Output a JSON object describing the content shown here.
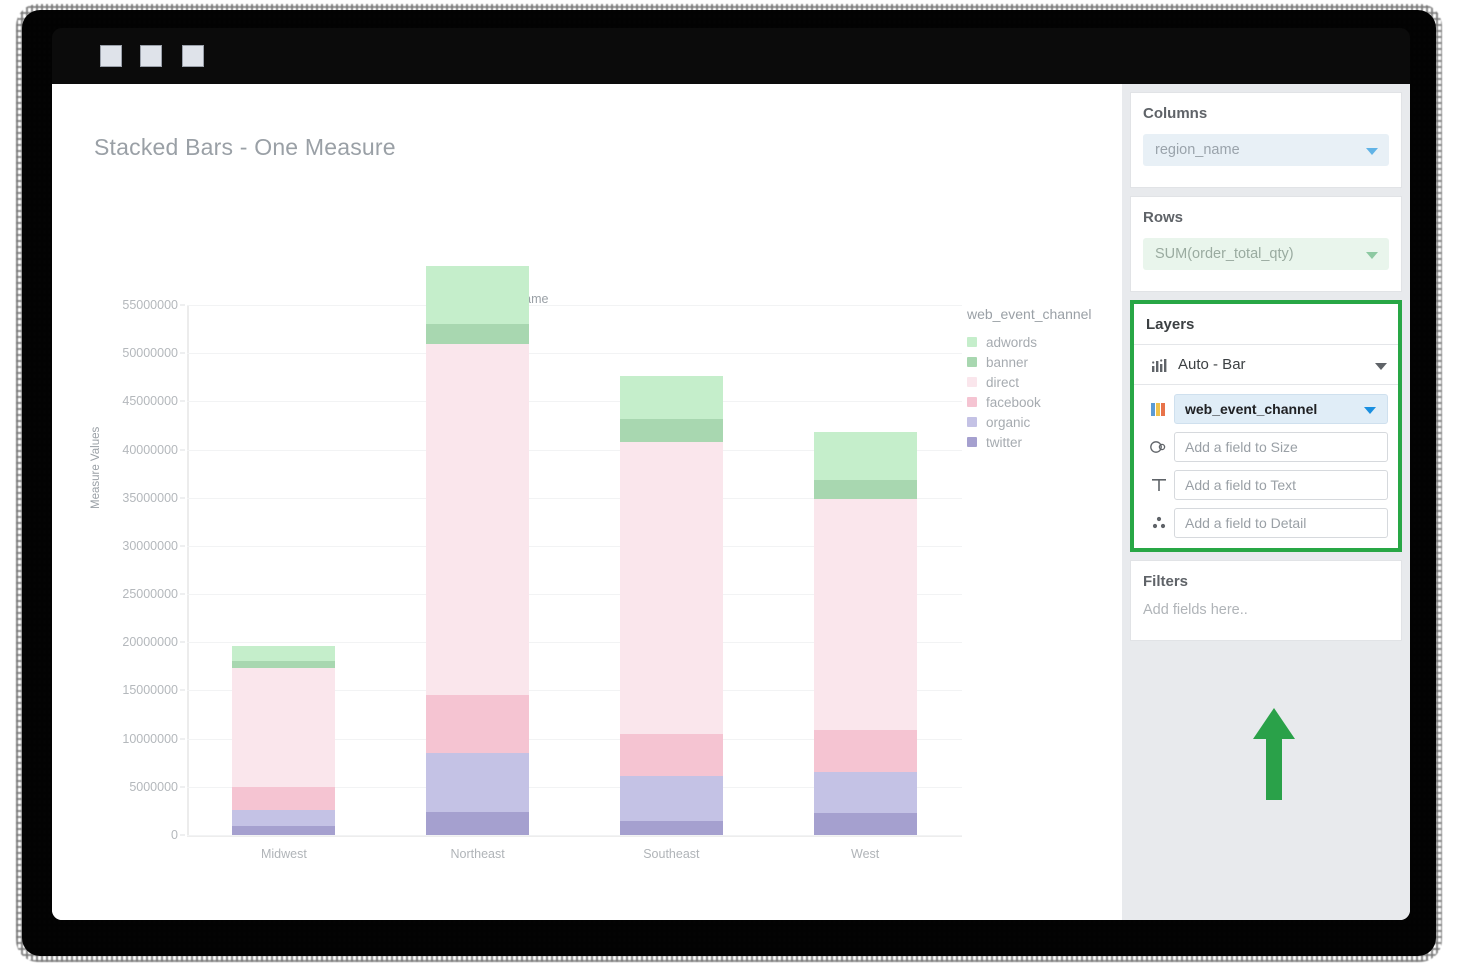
{
  "window": {
    "dots": [
      "window-dot-1",
      "window-dot-2",
      "window-dot-3"
    ]
  },
  "chart": {
    "title": "Stacked Bars - One Measure",
    "column_label": "region_name",
    "y_axis_title": "Measure Values",
    "legend_title": "web_event_channel"
  },
  "sidebar": {
    "columns": {
      "title": "Columns",
      "field": "region_name"
    },
    "rows": {
      "title": "Rows",
      "field": "SUM(order_total_qty)"
    },
    "layers": {
      "title": "Layers",
      "type": "Auto - Bar",
      "color_field": "web_event_channel",
      "size_placeholder": "Add a field to Size",
      "text_placeholder": "Add a field to Text",
      "detail_placeholder": "Add a field to Detail"
    },
    "filters": {
      "title": "Filters",
      "placeholder": "Add fields here.."
    }
  },
  "colors": {
    "adwords": "#c5eecb",
    "banner": "#a8d7b0",
    "direct": "#fae6ec",
    "facebook": "#f5c4d2",
    "organic": "#c4c2e5",
    "twitter": "#a5a0cf",
    "annotation": "#2aa149",
    "accent_blue": "#1a8fe0"
  },
  "chart_data": {
    "type": "bar",
    "stacked": true,
    "title": "Stacked Bars - One Measure",
    "xlabel": "region_name",
    "ylabel": "Measure Values",
    "grid": true,
    "legend_position": "right",
    "legend_title": "web_event_channel",
    "ylim": [
      0,
      55000000
    ],
    "ytick_labels": [
      "0",
      "5000000",
      "10000000",
      "15000000",
      "20000000",
      "25000000",
      "30000000",
      "35000000",
      "40000000",
      "45000000",
      "50000000",
      "55000000"
    ],
    "yticks": [
      0,
      5000000,
      10000000,
      15000000,
      20000000,
      25000000,
      30000000,
      35000000,
      40000000,
      45000000,
      50000000,
      55000000
    ],
    "categories": [
      "Midwest",
      "Northeast",
      "Southeast",
      "West"
    ],
    "series": [
      {
        "name": "twitter",
        "color": "#a5a0cf",
        "values": [
          900000,
          2400000,
          1500000,
          2300000
        ]
      },
      {
        "name": "organic",
        "color": "#c4c2e5",
        "values": [
          1700000,
          6100000,
          4600000,
          4200000
        ]
      },
      {
        "name": "facebook",
        "color": "#f5c4d2",
        "values": [
          2400000,
          6000000,
          4400000,
          4400000
        ]
      },
      {
        "name": "direct",
        "color": "#fae6ec",
        "values": [
          12300000,
          36500000,
          30300000,
          24000000
        ]
      },
      {
        "name": "banner",
        "color": "#a8d7b0",
        "values": [
          800000,
          2000000,
          2400000,
          1900000
        ]
      },
      {
        "name": "adwords",
        "color": "#c5eecb",
        "values": [
          1500000,
          6100000,
          4400000,
          5000000
        ]
      }
    ],
    "totals": [
      19600000,
      59100000,
      47600000,
      41800000
    ],
    "legend_entries": [
      "adwords",
      "banner",
      "direct",
      "facebook",
      "organic",
      "twitter"
    ]
  }
}
